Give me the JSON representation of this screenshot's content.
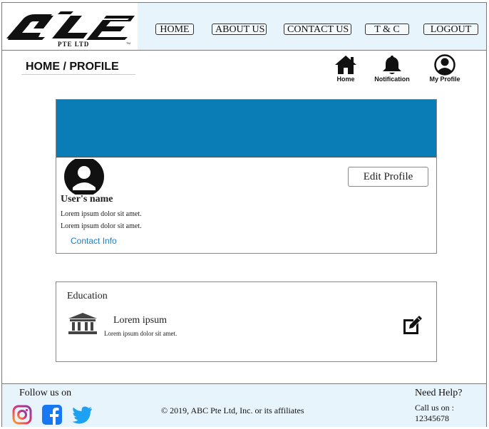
{
  "header": {
    "logo_tagline": "PTE LTD",
    "nav": [
      {
        "label": "HOME"
      },
      {
        "label": "ABOUT US"
      },
      {
        "label": "CONTACT US"
      },
      {
        "label": "T & C"
      },
      {
        "label": "LOGOUT"
      }
    ]
  },
  "breadcrumb": {
    "text": "HOME / PROFILE"
  },
  "quick_links": [
    {
      "label": "Home",
      "icon": "home-icon"
    },
    {
      "label": "Notification",
      "icon": "bell-icon"
    },
    {
      "label": "My Profile",
      "icon": "user-circle-icon"
    }
  ],
  "profile": {
    "banner_color": "#0b7db6",
    "user_name": "User's name",
    "line1": "Lorem ipsum dolor sit amet.",
    "line2": "Lorem ipsum dolor sit amet.",
    "contact_link": "Contact Info",
    "edit_button": "Edit Profile"
  },
  "education": {
    "title": "Education",
    "item_name": "Lorem ipsum",
    "item_desc": "Lorem ipsum dolor sit amet."
  },
  "footer": {
    "follow": "Follow us on",
    "copyright": "© 2019, ABC Pte Ltd, Inc. or its affiliates",
    "help": "Need Help?",
    "call_label": "Call us on :",
    "phone": "12345678",
    "social": [
      "instagram-icon",
      "facebook-icon",
      "twitter-icon"
    ]
  }
}
